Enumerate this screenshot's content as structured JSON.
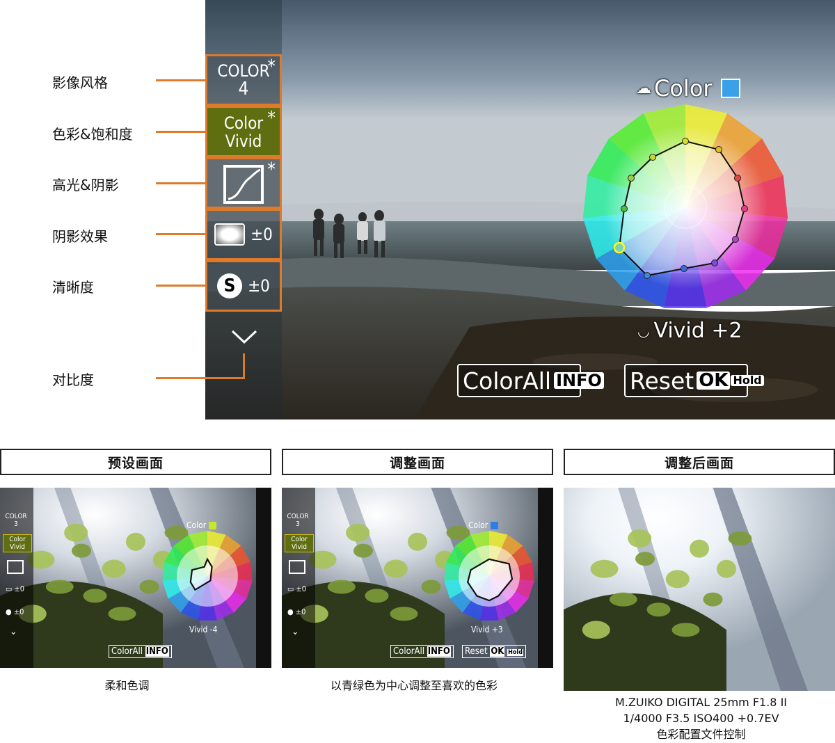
{
  "labels": {
    "picture_mode": "影像风格",
    "color_saturation": "色彩&饱和度",
    "highlight_shadow": "高光&阴影",
    "shading": "阴影效果",
    "clarity": "清晰度",
    "contrast": "对比度"
  },
  "menu": {
    "picture_mode_line1": "COLOR",
    "picture_mode_line2": "4",
    "color_vivid_line1": "Color",
    "color_vivid_line2": "Vivid",
    "shading_value": "±0",
    "clarity_value": "±0",
    "asterisk": "*",
    "clarity_glyph": "S"
  },
  "overlay": {
    "color_label": "Color",
    "vivid_label": "Vivid +2",
    "color_all": "ColorAll",
    "info_key": "INFO",
    "reset": "Reset",
    "ok_key": "OK",
    "hold_key": "Hold"
  },
  "panels": [
    {
      "header": "预设画面",
      "caption": "柔和色调",
      "menu_line1": "COLOR",
      "menu_line2": "3",
      "color_line1": "Color",
      "color_line2": "Vivid",
      "shading": "±0",
      "clarity": "±0",
      "color_label": "Color",
      "vivid_label": "Vivid -4",
      "color_all": "ColorAll",
      "info_key": "INFO",
      "swatch": "#c8e62a"
    },
    {
      "header": "调整画面",
      "caption": "以青绿色为中心调整至喜欢的色彩",
      "menu_line1": "COLOR",
      "menu_line2": "3",
      "color_line1": "Color",
      "color_line2": "Vivid",
      "shading": "±0",
      "clarity": "±0",
      "color_label": "Color",
      "vivid_label": "Vivid +3",
      "color_all": "ColorAll",
      "info_key": "INFO",
      "reset": "Reset",
      "ok_key": "OK",
      "hold_key": "Hold",
      "swatch": "#2a7ee6"
    },
    {
      "header": "调整后画面",
      "caption_line1": "M.ZUIKO DIGITAL 25mm F1.8 II",
      "caption_line2": "1/4000 F3.5 ISO400 +0.7EV",
      "caption_line3": "色彩配置文件控制"
    }
  ],
  "colors": {
    "accent_orange": "#e07a2b",
    "selected_green": "#5f6e10",
    "color_swatch": "#3aa0e8"
  }
}
